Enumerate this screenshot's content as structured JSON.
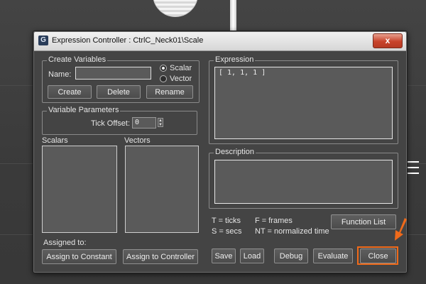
{
  "window": {
    "title": "Expression Controller : CtrlC_Neck01\\Scale",
    "close_symbol": "x"
  },
  "create_variables": {
    "label": "Create Variables",
    "name_label": "Name:",
    "name_value": "",
    "radio_scalar": "Scalar",
    "radio_vector": "Vector",
    "selected": "Scalar",
    "create": "Create",
    "delete": "Delete",
    "rename": "Rename"
  },
  "variable_parameters": {
    "label": "Variable Parameters",
    "tick_offset_label": "Tick Offset:",
    "tick_offset_value": "0"
  },
  "lists": {
    "scalars_label": "Scalars",
    "vectors_label": "Vectors"
  },
  "assign": {
    "assigned_to_label": "Assigned to:",
    "assign_constant": "Assign to Constant",
    "assign_controller": "Assign to Controller"
  },
  "expression": {
    "label": "Expression",
    "value": "[ 1, 1, 1 ]"
  },
  "description": {
    "label": "Description",
    "value": ""
  },
  "legend": {
    "t": "T = ticks",
    "f": "F = frames",
    "s": "S = secs",
    "nt": "NT = normalized time"
  },
  "buttons": {
    "function_list": "Function List",
    "save": "Save",
    "load": "Load",
    "debug": "Debug",
    "evaluate": "Evaluate",
    "close": "Close"
  },
  "colors": {
    "highlight": "#f06a1a",
    "window_bg": "#444444"
  }
}
